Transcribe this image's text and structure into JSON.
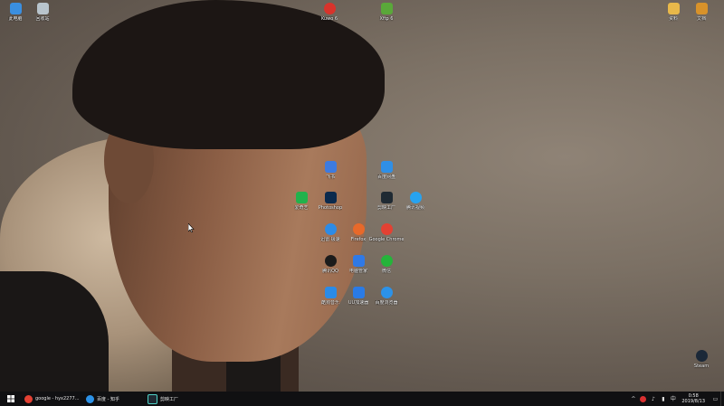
{
  "desktop": {
    "icons": [
      {
        "id": "computer",
        "label": "此电脑",
        "icon": "monitor-icon",
        "color": "#3a8fe0"
      },
      {
        "id": "recycle",
        "label": "回收站",
        "icon": "recycle-bin-icon",
        "color": "#b8c4cc"
      },
      {
        "id": "kuwo",
        "label": "Kuwo 6",
        "icon": "kuwo-icon",
        "color": "#d8332b"
      },
      {
        "id": "xshell",
        "label": "Xftp 6",
        "icon": "xftp-icon",
        "color": "#5aa83a"
      },
      {
        "id": "folder",
        "label": "资料",
        "icon": "folder-icon",
        "color": "#e8b84a"
      },
      {
        "id": "doc",
        "label": "文档",
        "icon": "document-icon",
        "color": "#d8922a"
      },
      {
        "id": "feishu",
        "label": "飞书",
        "icon": "feishu-icon",
        "color": "#3d7be0"
      },
      {
        "id": "baidunetdisk",
        "label": "百度网盘",
        "icon": "baidu-netdisk-icon",
        "color": "#2f8fe6"
      },
      {
        "id": "iqiyi",
        "label": "爱奇艺",
        "icon": "iqiyi-icon",
        "color": "#22b24c"
      },
      {
        "id": "photoshop",
        "label": "Photoshop",
        "icon": "photoshop-icon",
        "color": "#0b2a4d"
      },
      {
        "id": "jianying",
        "label": "剪映工厂",
        "icon": "jianying-icon",
        "color": "#1f2a33"
      },
      {
        "id": "tencentvideo",
        "label": "腾讯视频",
        "icon": "tencent-video-icon",
        "color": "#27a3f0"
      },
      {
        "id": "edge",
        "label": "迅雷 极速",
        "icon": "thunder-icon",
        "color": "#2d8be6"
      },
      {
        "id": "firefox",
        "label": "Firefox",
        "icon": "firefox-icon",
        "color": "#e8692a"
      },
      {
        "id": "chrome",
        "label": "Google Chrome",
        "icon": "chrome-icon",
        "color": "#e34133"
      },
      {
        "id": "qq",
        "label": "腾讯QQ",
        "icon": "qq-icon",
        "color": "#1b1b1b"
      },
      {
        "id": "pcmanager",
        "label": "电脑管家",
        "icon": "shield-icon",
        "color": "#2f79e6"
      },
      {
        "id": "wechat",
        "label": "微信",
        "icon": "wechat-icon",
        "color": "#25b43a"
      },
      {
        "id": "kugou",
        "label": "酷狗音乐",
        "icon": "kugou-icon",
        "color": "#2a8be8"
      },
      {
        "id": "uu",
        "label": "UU加速器",
        "icon": "uu-icon",
        "color": "#2a7be6"
      },
      {
        "id": "edgebrowser",
        "label": "百度浏览器",
        "icon": "browser-icon",
        "color": "#2c92e8"
      },
      {
        "id": "steam",
        "label": "Steam",
        "icon": "steam-icon",
        "color": "#1b2838"
      }
    ]
  },
  "taskbar": {
    "start_icon": "windows-start-icon",
    "apps": [
      {
        "label": "google - hyx2277...",
        "icon": "chrome-icon",
        "color": "#e34133"
      },
      {
        "label": "百度 - 知乎",
        "icon": "browser-icon",
        "color": "#2c92e8"
      },
      {
        "label": "剪映工厂",
        "icon": "jianying-icon",
        "color": "#1f2a33"
      }
    ],
    "tray": {
      "lang": "中",
      "time": "0:58",
      "date": "2019/8/13"
    }
  }
}
